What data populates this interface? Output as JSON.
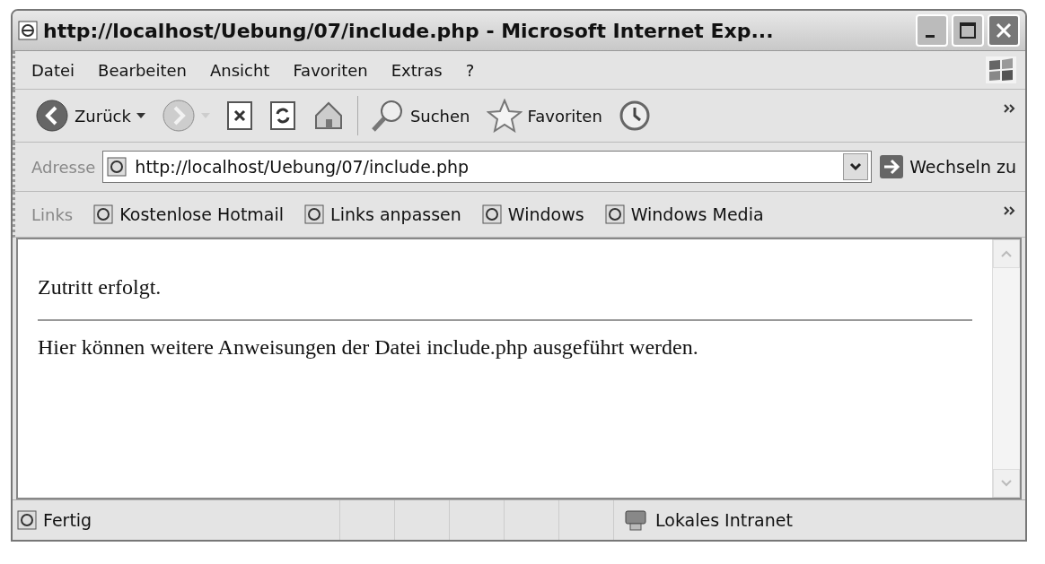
{
  "window": {
    "title": "http://localhost/Uebung/07/include.php - Microsoft Internet Exp..."
  },
  "menu": [
    "Datei",
    "Bearbeiten",
    "Ansicht",
    "Favoriten",
    "Extras",
    "?"
  ],
  "toolbar": [
    {
      "kind": "back",
      "label": "Zurück",
      "dropdown": true,
      "disabled": false
    },
    {
      "kind": "forward",
      "dropdown": true,
      "disabled": true
    },
    {
      "kind": "stop",
      "dropdown": false,
      "disabled": false
    },
    {
      "kind": "refresh",
      "dropdown": false,
      "disabled": false
    },
    {
      "kind": "home",
      "dropdown": false,
      "disabled": false
    },
    {
      "kind": "search",
      "label": "Suchen",
      "dropdown": false,
      "disabled": false
    },
    {
      "kind": "favorites",
      "label": "Favoriten",
      "dropdown": false,
      "disabled": false
    },
    {
      "kind": "history",
      "dropdown": false,
      "disabled": false
    }
  ],
  "address": {
    "label": "Adresse",
    "value": "http://localhost/Uebung/07/include.php",
    "go": "Wechseln zu"
  },
  "links": {
    "label": "Links",
    "items": [
      "Kostenlose Hotmail",
      "Links anpassen",
      "Windows",
      "Windows Media"
    ]
  },
  "content": {
    "paragraphs": [
      "Zutritt erfolgt.",
      "Hier können weitere Anweisungen der Datei include.php ausgeführt werden."
    ]
  },
  "status_bar": {
    "text": "Fertig",
    "zone": "Lokales Intranet"
  }
}
